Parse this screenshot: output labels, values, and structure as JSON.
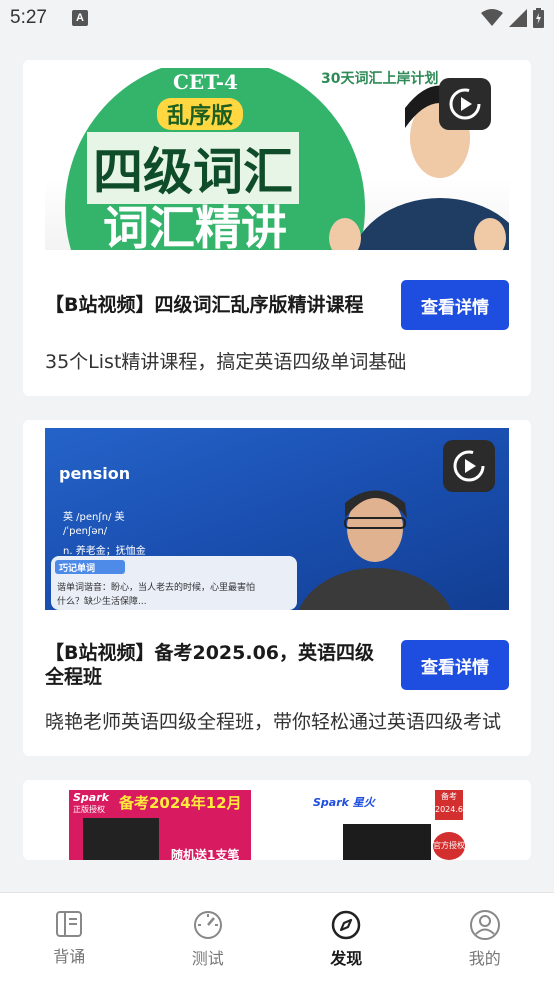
{
  "status": {
    "time": "5:27"
  },
  "cards": [
    {
      "thumb": {
        "badge": "CET-4",
        "tag": "乱序版",
        "headline1": "四级词汇",
        "headline2": "词汇精讲",
        "corner": "30天词汇上岸计划"
      },
      "title": "【B站视频】四级词汇乱序版精讲课程",
      "button": "查看详情",
      "desc": "35个List精讲课程，搞定英语四级单词基础"
    },
    {
      "thumb": {
        "word": "pension",
        "phonetic1": "英 /penʃn/ 美",
        "phonetic2": "/ˈpenʃən/",
        "meaning": "n. 养老金；抚恤金",
        "tip_title": "巧记单词",
        "tip_line1": "谐单词谐音：盼心，当人老去的时候，心里最害怕",
        "tip_line2": "什么？缺少生活保障..."
      },
      "title": "【B站视频】备考2025.06，英语四级全程班",
      "button": "查看详情",
      "desc": "晓艳老师英语四级全程班，带你轻松通过英语四级考试"
    },
    {
      "promo": {
        "left_brand": "Spark",
        "left_tag": "正版授权",
        "left_headline": "备考2024年12月",
        "left_sub": "随机送1支笔",
        "right_brand": "Spark 星火",
        "right_badge_top": "备考",
        "right_badge_date": "2024.6",
        "right_badge_auth": "官方授权"
      }
    }
  ],
  "nav": [
    {
      "label": "背诵",
      "icon": "book-icon",
      "active": false
    },
    {
      "label": "测试",
      "icon": "gauge-icon",
      "active": false
    },
    {
      "label": "发现",
      "icon": "compass-icon",
      "active": true
    },
    {
      "label": "我的",
      "icon": "user-icon",
      "active": false
    }
  ],
  "colors": {
    "accent": "#1d4ee0",
    "background": "#f2f3f5"
  }
}
